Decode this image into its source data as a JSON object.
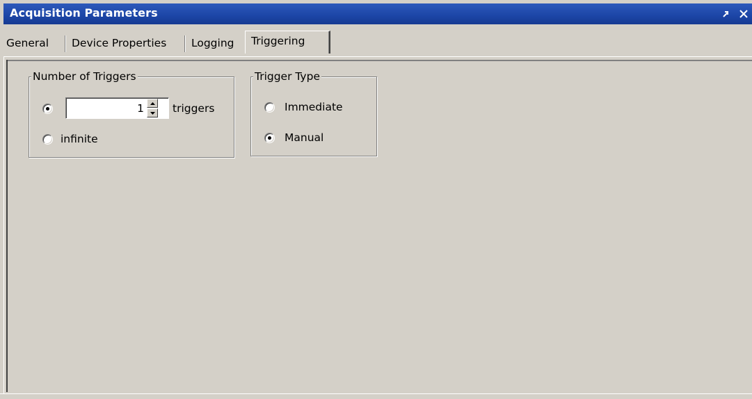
{
  "window": {
    "title": "Acquisition Parameters",
    "undock_icon": "undock-arrow-icon",
    "close_icon": "close-icon"
  },
  "tabs": [
    {
      "label": "General",
      "active": false
    },
    {
      "label": "Device Properties",
      "active": false
    },
    {
      "label": "Logging",
      "active": false
    },
    {
      "label": "Triggering",
      "active": true
    }
  ],
  "triggering": {
    "number_of_triggers": {
      "legend": "Number of Triggers",
      "count_value": "1",
      "count_unit": "triggers",
      "infinite_label": "infinite",
      "selected": "count"
    },
    "trigger_type": {
      "legend": "Trigger Type",
      "options": [
        {
          "label": "Immediate",
          "selected": false
        },
        {
          "label": "Manual",
          "selected": true
        }
      ]
    }
  },
  "colors": {
    "titlebar": "#1c45a6",
    "face": "#d4d0c8"
  }
}
